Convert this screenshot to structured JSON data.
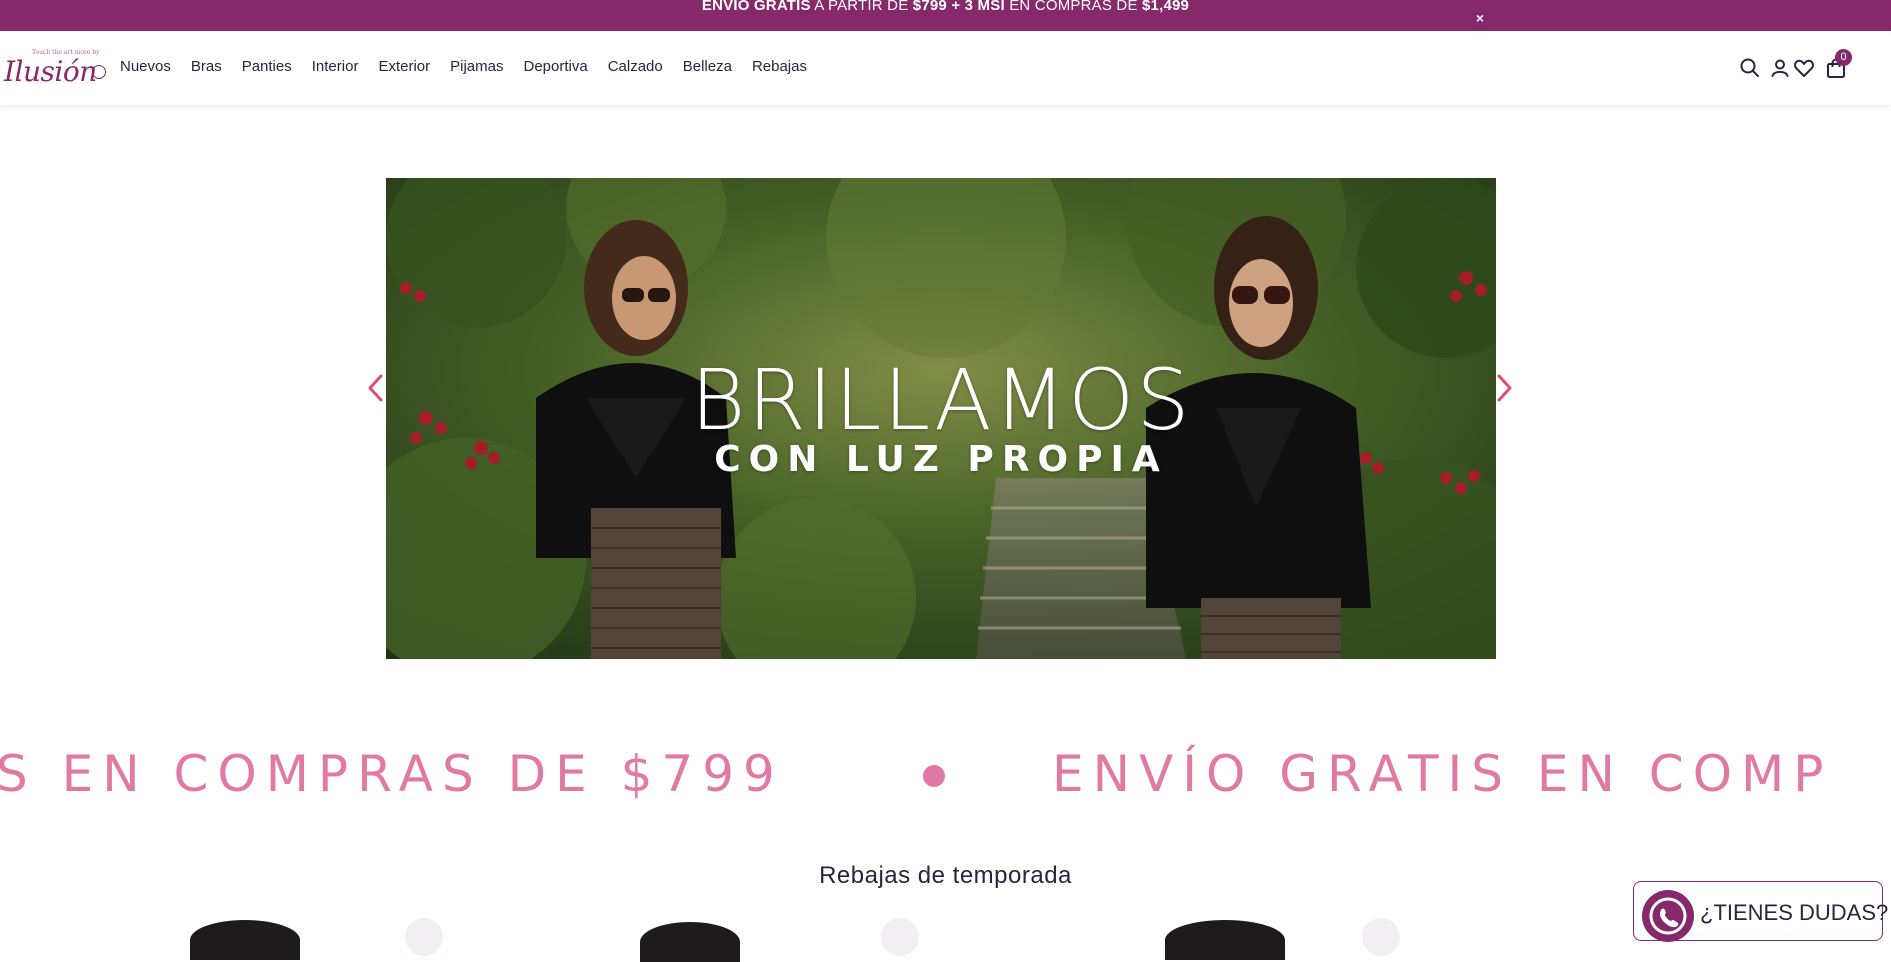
{
  "announcement": {
    "part1": "ENVÍO GRATIS",
    "part2": " A PARTIR DE ",
    "part3": "$799 + 3 MSI",
    "part4": " EN COMPRAS DE ",
    "part5": "$1,499",
    "close_label": "×"
  },
  "header": {
    "logo_text": "Ilusión",
    "logo_tagline": "Touch the art more by",
    "nav": [
      "Nuevos",
      "Bras",
      "Panties",
      "Interior",
      "Exterior",
      "Pijamas",
      "Deportiva",
      "Calzado",
      "Belleza",
      "Rebajas"
    ],
    "icons": [
      "search-icon",
      "user-icon",
      "heart-icon",
      "bag-icon"
    ],
    "cart_count": "0"
  },
  "hero": {
    "headline": "BRILLAMOS",
    "subheadline": "CON LUZ PROPIA",
    "prev_icon": "chevron-left-icon",
    "next_icon": "chevron-right-icon"
  },
  "marquee": {
    "left_text": "S EN COMPRAS DE $799",
    "right_text": "ENVÍO GRATIS EN COMP"
  },
  "section": {
    "title": "Rebajas de temporada"
  },
  "whatsapp": {
    "label": "¿TIENES DUDAS?",
    "icon": "whatsapp-icon"
  },
  "colors": {
    "brand": "#85296b",
    "marquee": "#e07aa5",
    "text": "#2b2340"
  }
}
